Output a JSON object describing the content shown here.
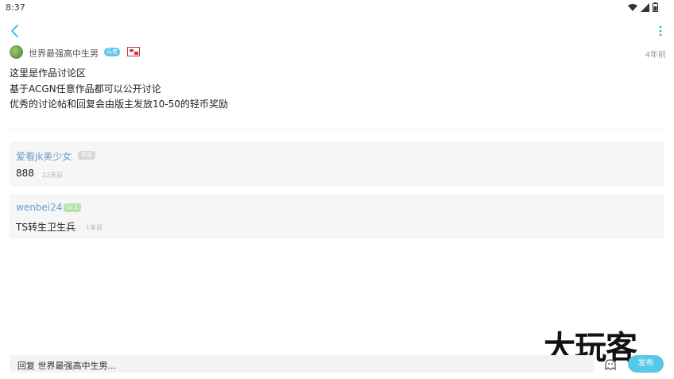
{
  "status_bar": {
    "time": "8:37",
    "icons": [
      "wifi-icon",
      "signal-icon",
      "battery-icon"
    ]
  },
  "top_bar": {
    "back_icon": "chevron-left-icon",
    "more_icon": "more-vertical-icon",
    "accent_color": "#2bbfd9"
  },
  "post": {
    "author": {
      "name": "世界最强高中生男",
      "badge": "元老",
      "badge_color": "#5ec7e8"
    },
    "time": "4年前",
    "lines": [
      "这里是作品讨论区",
      "基于ACGN任意作品都可以公开讨论",
      "优秀的讨论帖和回复会由版主发放10-50的轻币奖励"
    ]
  },
  "comments": [
    {
      "user": "爱看jk美少女",
      "badge": "学员",
      "text": "888",
      "time": "22天前"
    },
    {
      "user": "wenbei24",
      "badge": "Lv.1",
      "text": "TS转生卫生兵",
      "time": "1年前"
    }
  ],
  "reply_bar": {
    "placeholder": "回复 世界最强高中生男...",
    "emoji_icon": "emoji-icon",
    "publish_label": "发布",
    "publish_color": "#57c9e6"
  },
  "watermark": {
    "text": "大玩客"
  }
}
